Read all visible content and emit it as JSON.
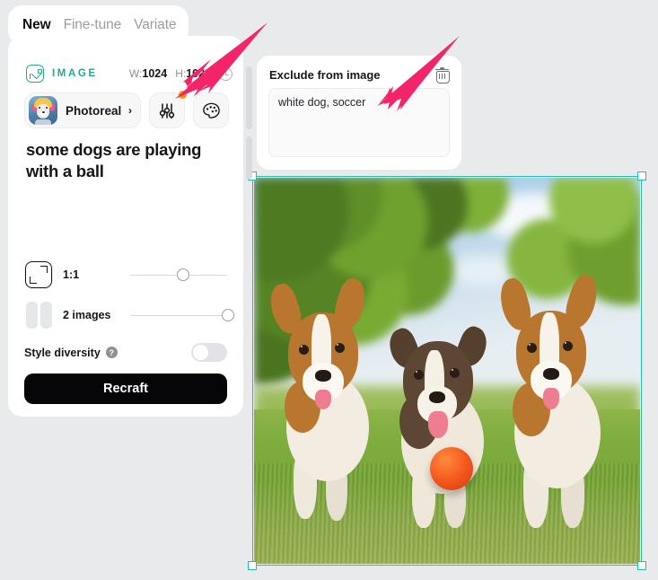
{
  "tabs": [
    {
      "label": "New",
      "active": true
    },
    {
      "label": "Fine-tune",
      "active": false
    },
    {
      "label": "Variate",
      "active": false
    }
  ],
  "generator_panel": {
    "badge_icon": "image-icon",
    "badge_label": "IMAGE",
    "width_prefix": "W:",
    "width_value": "1024",
    "height_prefix": "H:",
    "height_value": "1024",
    "history_icon": "clock-icon",
    "style": {
      "thumbnail_alt": "dog-in-helmet-thumbnail",
      "name": "Photoreal",
      "chevron": "›"
    },
    "settings_icon": "sliders-icon",
    "settings_badge": "new-indicator-dot",
    "palette_icon": "palette-icon",
    "prompt": "some dogs are playing with a ball",
    "aspect_ratio": {
      "icon": "aspect-ratio-icon",
      "label": "1:1",
      "slider_value": 48
    },
    "image_count": {
      "icon": "image-count-icon",
      "label": "2 images",
      "slider_value": 100
    },
    "style_diversity": {
      "label": "Style diversity",
      "help_icon": "help-icon",
      "help_glyph": "?",
      "enabled": false
    },
    "submit_label": "Recraft"
  },
  "exclude_panel": {
    "title": "Exclude from image",
    "delete_icon": "trash-icon",
    "text": "white dog, soccer",
    "placeholder": ""
  },
  "canvas": {
    "selection_color": "#25bdb0",
    "handles": [
      "top-left",
      "top-right",
      "bottom-left",
      "bottom-right"
    ],
    "artwork_alt": "three-dogs-running-with-orange-ball-in-park"
  },
  "annotations": {
    "arrow_color": "#f4246b",
    "arrows": [
      {
        "name": "arrow-to-settings-badge"
      },
      {
        "name": "arrow-to-exclude-textarea"
      }
    ]
  },
  "colors": {
    "background": "#e9eaec",
    "panel": "#ffffff",
    "accent_teal": "#1fab93",
    "accent_magenta": "#f4246b",
    "badge_orange": "#ff9800",
    "submit_bg": "#060608"
  }
}
